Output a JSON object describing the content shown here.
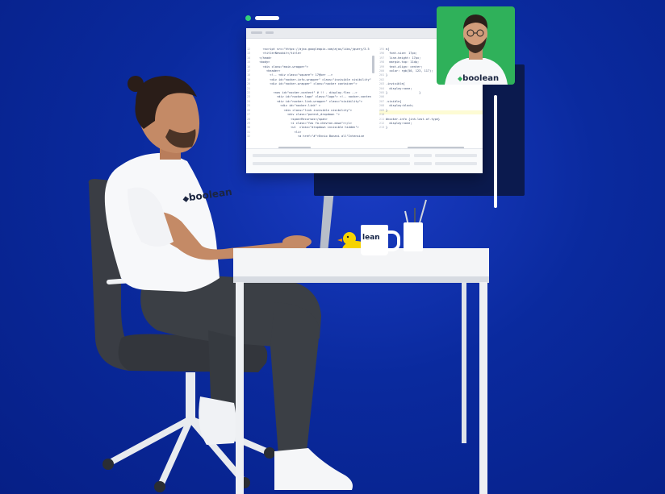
{
  "brand": {
    "name": "boolean",
    "webcam_logo_text": "boolean",
    "mug_text": "lean",
    "shirt_text": "boolean",
    "accent_green": "#2fb15a",
    "background_blue": "#0a2a9e"
  },
  "editor": {
    "left_lines": [
      {
        "n": "12",
        "code": "    <script src=\"https://ajax.googleapis.com/ajax/libs/jquery/3.5"
      },
      {
        "n": "13",
        "code": "    <title>Nevobit</title>"
      },
      {
        "n": "14",
        "code": "  </head>"
      },
      {
        "n": "15",
        "code": "  <body>"
      },
      {
        "n": "16",
        "code": "    <div class=\"main-wrapper\">"
      },
      {
        "n": "17",
        "code": "      <header>"
      },
      {
        "n": "18",
        "code": "        <!-- <div class=\"square\"> 17@ker -->"
      },
      {
        "n": "19",
        "code": "        <div id=\"nocker-info-wrapper\" class=\"invisible visibility\">"
      },
      {
        "n": "20",
        "code": "        <div id=\"nocker-wrapper\" class=\"nocker container\">"
      },
      {
        "n": "21",
        "code": ""
      },
      {
        "n": "22",
        "code": "          <nav id=\"nocker-content\" # !! - display.flex -->"
      },
      {
        "n": "23",
        "code": "            <div id=\"nocker-logo\" class=\"logo\"> <!-- nocker-content"
      },
      {
        "n": "24",
        "code": "            <div id=\"nocker-link-wrapper\" class=\"visibility\">"
      },
      {
        "n": "25",
        "code": "              <div id=\"nocker-link\" >"
      },
      {
        "n": "26",
        "code": "                <div class=\"link invisible visibility\">"
      },
      {
        "n": "27",
        "code": "                  <div class=\"parent_dropdown \">"
      },
      {
        "n": "28",
        "code": "                    <span>Recursos</span>"
      },
      {
        "n": "29",
        "code": "                    <i class=\"fas fa-chevron-down\"></i>"
      },
      {
        "n": "30",
        "code": "                    <ul  class=\"dropdown invisible hidden\">"
      },
      {
        "n": "31",
        "code": "                      <li>"
      },
      {
        "n": "32",
        "code": "                        <a href=\"#\">Ennio Bonani all\"Intensive"
      }
    ],
    "right_lines": [
      {
        "n": "195",
        "code": "e{"
      },
      {
        "n": "196",
        "code": "  font-size: 17px;"
      },
      {
        "n": "197",
        "code": "  line-height: 17px;"
      },
      {
        "n": "198",
        "code": "  margin-top: 11dp;"
      },
      {
        "n": "199",
        "code": "  text-align: center;"
      },
      {
        "n": "200",
        "code": "  color: rgb(50, 123, 117);"
      },
      {
        "n": "201",
        "code": "}"
      },
      {
        "n": "202",
        "code": ""
      },
      {
        "n": "203",
        "code": ".invisible{"
      },
      {
        "n": "204",
        "code": "  display:none;"
      },
      {
        "n": "205",
        "code": "}                  }"
      },
      {
        "n": "206",
        "code": ""
      },
      {
        "n": "207",
        "code": ".visible{"
      },
      {
        "n": "208",
        "code": "  display:block;"
      },
      {
        "n": "209",
        "code": "}"
      },
      {
        "n": "210",
        "code": ""
      },
      {
        "n": "211",
        "code": "#nocker-info {inh-last-of-type}"
      },
      {
        "n": "212",
        "code": "  display:none;"
      },
      {
        "n": "213",
        "code": "}"
      }
    ]
  }
}
